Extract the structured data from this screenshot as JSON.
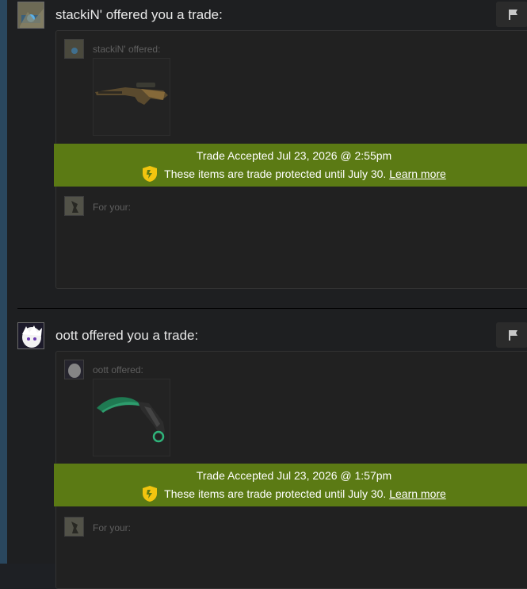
{
  "trades": [
    {
      "title": "stackiN' offered you a trade:",
      "offered_label": "stackiN' offered:",
      "item_icon": "sniper-rifle-skin",
      "accepted_text": "Trade Accepted Jul 23, 2026 @ 2:55pm",
      "protected_text": "These items are trade protected until July 30.",
      "learn_more": "Learn more",
      "your_label": "For your:"
    },
    {
      "title": "oott offered you a trade:",
      "offered_label": "oott offered:",
      "item_icon": "karambit-knife-skin",
      "accepted_text": "Trade Accepted Jul 23, 2026 @ 1:57pm",
      "protected_text": "These items are trade protected until July 30.",
      "learn_more": "Learn more",
      "your_label": "For your:"
    }
  ],
  "icons": {
    "report": "flag-icon",
    "protection": "shield-icon"
  },
  "colors": {
    "banner": "#5b7a14",
    "background": "#1e1f21",
    "sidebar": "#2a475e"
  }
}
